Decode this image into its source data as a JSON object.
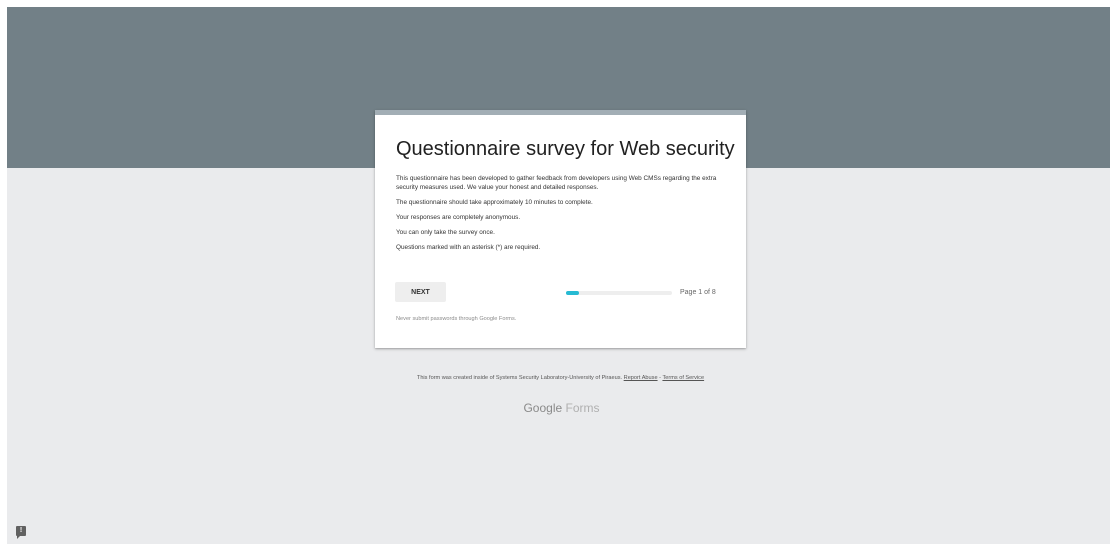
{
  "form": {
    "title": "Questionnaire survey for Web security",
    "description": [
      "This questionnaire has been developed to gather feedback from developers using Web CMSs regarding the extra security measures used. We value your honest and detailed responses.",
      "The questionnaire should take approximately 10 minutes to complete.",
      "Your responses are completely anonymous.",
      "You can only take the survey once.",
      "Questions marked with an asterisk (*) are required."
    ],
    "next_label": "NEXT",
    "progress": {
      "current_page": 1,
      "total_pages": 8,
      "fraction": 0.125,
      "label": "Page 1 of 8"
    },
    "warning": "Never submit passwords through Google Forms."
  },
  "footer": {
    "created_text": "This form was created inside of Systems Security Laboratory-University of Piraeus.",
    "report_abuse": "Report Abuse",
    "separator": " - ",
    "terms": "Terms of Service"
  },
  "brand": {
    "strong": "Google",
    "light": " Forms"
  },
  "feedback": {
    "icon": "feedback-exclamation-icon",
    "glyph": "!"
  },
  "colors": {
    "header_band": "#728087",
    "page_background": "#eaebed",
    "card_top_bar": "#a2aeb5",
    "progress_fill": "#26bad3"
  }
}
